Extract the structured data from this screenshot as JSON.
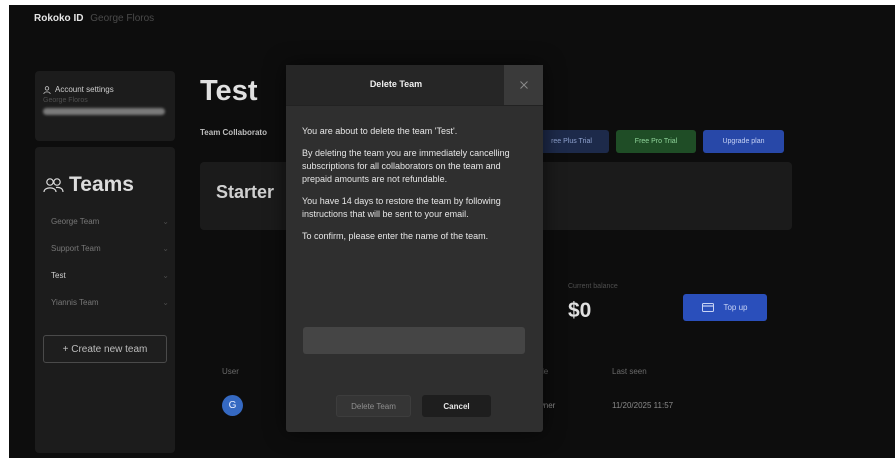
{
  "topbar": {
    "brand": "Rokoko ID",
    "user_name": "George Floros"
  },
  "sidebar": {
    "account_settings_label": "Account settings",
    "account_user_name": "George Floros",
    "teams_heading": "Teams",
    "teams": [
      {
        "label": "George Team"
      },
      {
        "label": "Support Team"
      },
      {
        "label": "Test"
      },
      {
        "label": "Yiannis Team"
      }
    ],
    "create_team_label": "+ Create new team"
  },
  "main": {
    "title": "Test",
    "collaborators_label": "Team Collaborato",
    "plan_buttons": {
      "free_plus_trial": "ree Plus Trial",
      "free_pro_trial": "Free Pro Trial",
      "upgrade_plan": "Upgrade plan"
    },
    "plan_card_title": "Starter",
    "balance_label": "Current balance",
    "balance_value": "$0",
    "top_up_label": "Top up",
    "table": {
      "headers": {
        "user": "User",
        "role": "le",
        "last_seen": "Last seen"
      },
      "rows": [
        {
          "avatar_initial": "G",
          "role": "wner",
          "last_seen": "11/20/2025 11:57"
        }
      ]
    }
  },
  "modal": {
    "title": "Delete Team",
    "paragraphs": [
      "You are about to delete the team 'Test'.",
      "By deleting the team you are immediately cancelling subscriptions for all collaborators on the team and prepaid amounts are not refundable.",
      "You have 14 days to restore the team by following instructions that will be sent to your email.",
      "To confirm, please enter the name of the team."
    ],
    "confirm_input_value": "",
    "delete_button_label": "Delete Team",
    "cancel_button_label": "Cancel"
  }
}
